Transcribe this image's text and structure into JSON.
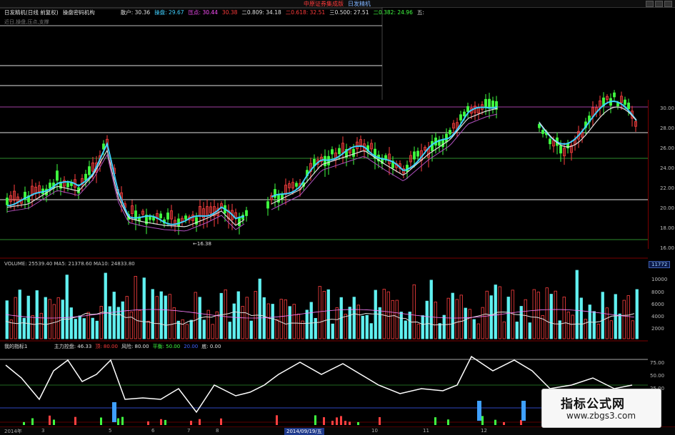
{
  "title_bar": {
    "broker": "中原证券集成版",
    "product": "日发精机",
    "colors": {
      "broker": "#ff3b3b",
      "product": "#7fb3ff"
    }
  },
  "header": {
    "stock": "日发精机(日线 前复权)",
    "formula": "操盘密码机构",
    "indicators": [
      {
        "label": "散户",
        "value": "30.36",
        "color": "#e0e0e0"
      },
      {
        "label": "操盘",
        "value": "29.67",
        "color": "#40d0ff"
      },
      {
        "label": "压点",
        "value": "30.44",
        "color": "#ff50ff"
      },
      {
        "label": "",
        "value": "30.38",
        "color": "#ff3b3b"
      },
      {
        "label": "二0.809",
        "value": "34.18",
        "color": "#e0e0e0"
      },
      {
        "label": "二0.618",
        "value": "32.51",
        "color": "#ff3b3b"
      },
      {
        "label": "三0.500",
        "value": "27.51",
        "color": "#e0e0e0"
      },
      {
        "label": "二0.382",
        "value": "24.96",
        "color": "#40ff40"
      },
      {
        "label": "五",
        "value": "",
        "color": "#e0e0e0"
      }
    ]
  },
  "sub_header": "近日,操盘,压点,支撑",
  "price_annotation": "←16.38",
  "price_axis": [
    "30.00",
    "28.00",
    "26.00",
    "24.00",
    "22.00",
    "20.00",
    "18.00",
    "16.00"
  ],
  "volume": {
    "legend": "VOLUME: 25539.40  MA5: 21378.60  MA10: 24833.80",
    "badge": "11772",
    "axis": [
      "10000",
      "8000",
      "6000",
      "4000",
      "2000"
    ]
  },
  "indicator": {
    "name": "我的指标1",
    "items": [
      {
        "label": "主力控盘:",
        "value": "46.33",
        "color": "#e0e0e0"
      },
      {
        "label": "顶:",
        "value": "80.00",
        "color": "#ff3b3b"
      },
      {
        "label": "风险:",
        "value": "80.00",
        "color": "#e0e0e0"
      },
      {
        "label": "平衡:",
        "value": "50.00",
        "color": "#40ff40"
      },
      {
        "label": "",
        "value": "20.00",
        "color": "#4060ff"
      },
      {
        "label": "底:",
        "value": "0.00",
        "color": "#e0e0e0"
      }
    ],
    "axis": [
      "75.00",
      "50.00",
      "25.00"
    ]
  },
  "dates": [
    {
      "text": "2014年",
      "selected": false
    },
    {
      "text": "3",
      "selected": false
    },
    {
      "text": "5",
      "selected": false
    },
    {
      "text": "6",
      "selected": false
    },
    {
      "text": "7",
      "selected": false
    },
    {
      "text": "8",
      "selected": false
    },
    {
      "text": "2014/09/19/五",
      "selected": true
    },
    {
      "text": "10",
      "selected": false
    },
    {
      "text": "11",
      "selected": false
    },
    {
      "text": "12",
      "selected": false
    }
  ],
  "watermark": {
    "title": "指标公式网",
    "url": "www.zbgs3.com"
  }
}
